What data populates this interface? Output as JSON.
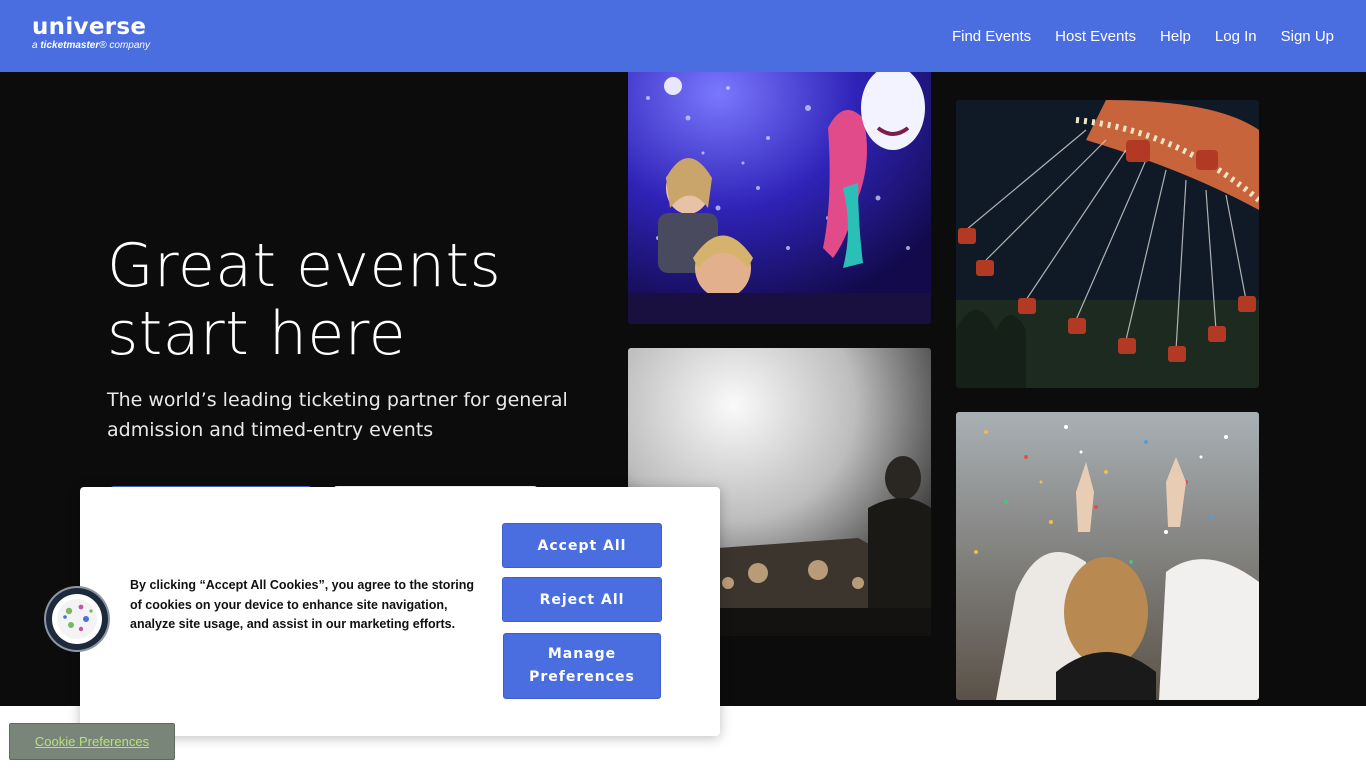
{
  "header": {
    "logo_word": "universe",
    "logo_tag_prefix": "a ",
    "logo_tag_brand": "ticketmaster",
    "logo_tag_suffix": "® company",
    "nav": [
      "Find Events",
      "Host Events",
      "Help",
      "Log In",
      "Sign Up"
    ],
    "brand_color": "#4a6ee0"
  },
  "hero": {
    "headline_line1": "Great events",
    "headline_line2": "start here",
    "subline": "The world’s leading ticketing partner for general admission and timed-entry events"
  },
  "photos": [
    "bubbles-concert-photo",
    "swing-ride-photo",
    "dj-booth-photo",
    "confetti-crowd-photo"
  ],
  "cookie_banner": {
    "text": "By clicking “Accept All Cookies”, you agree to the storing of cookies on your device to enhance site navigation, analyze site usage, and assist in our marketing efforts.",
    "accept": "Accept All",
    "reject": "Reject All",
    "manage": "Manage Preferences"
  },
  "cookie_icon": "cookie-icon",
  "cookie_preferences_link": "Cookie Preferences"
}
